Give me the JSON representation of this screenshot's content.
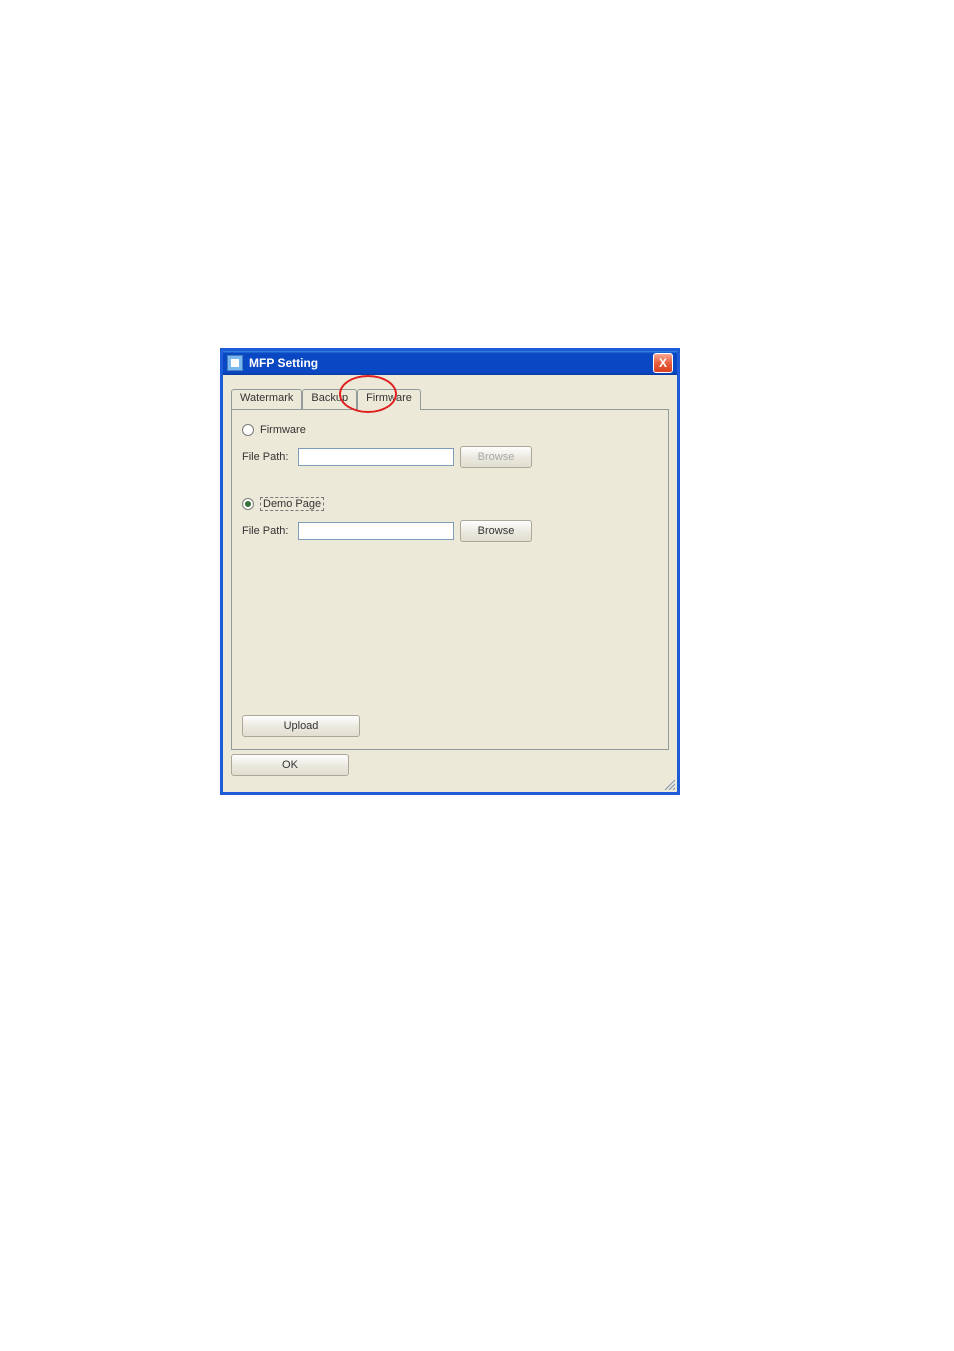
{
  "window": {
    "title": "MFP Setting"
  },
  "tabs": {
    "watermark": "Watermark",
    "backup": "Backup",
    "firmware": "Firmware"
  },
  "section_firmware": {
    "radio_label": "Firmware",
    "file_path_label": "File Path:",
    "file_path_value": "",
    "browse_label": "Browse"
  },
  "section_demo": {
    "radio_label": "Demo Page",
    "file_path_label": "File Path:",
    "file_path_value": "",
    "browse_label": "Browse"
  },
  "buttons": {
    "upload": "Upload",
    "ok": "OK",
    "close": "X"
  }
}
